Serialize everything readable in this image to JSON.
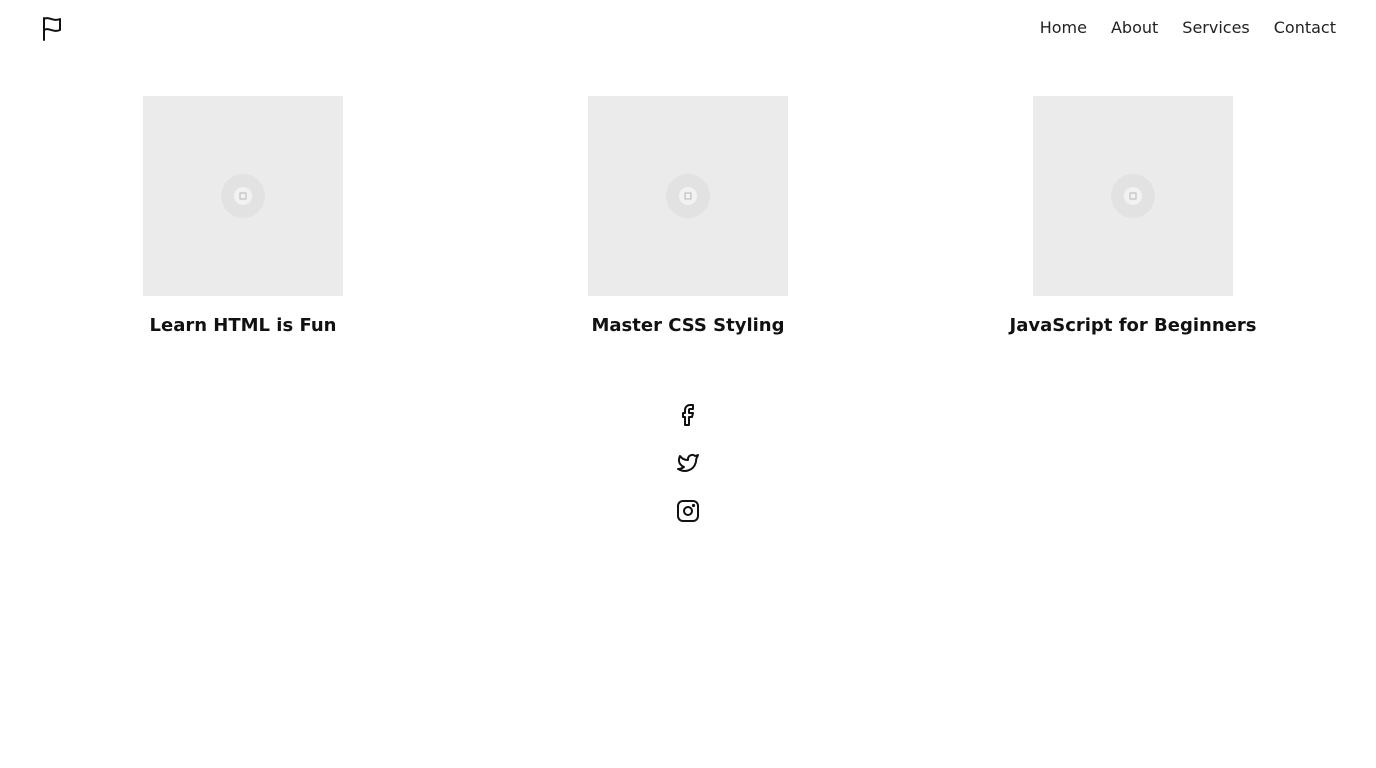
{
  "header": {
    "logo_icon": "flag-icon",
    "nav": [
      {
        "label": "Home"
      },
      {
        "label": "About"
      },
      {
        "label": "Services"
      },
      {
        "label": "Contact"
      }
    ]
  },
  "cards": [
    {
      "title": "Learn HTML is Fun",
      "image_icon": "image-placeholder-icon"
    },
    {
      "title": "Master CSS Styling",
      "image_icon": "image-placeholder-icon"
    },
    {
      "title": "JavaScript for Beginners",
      "image_icon": "image-placeholder-icon"
    }
  ],
  "social": [
    {
      "icon": "facebook-icon"
    },
    {
      "icon": "twitter-icon"
    },
    {
      "icon": "instagram-icon"
    }
  ],
  "colors": {
    "background": "#ffffff",
    "text": "#111111",
    "placeholder": "#ebebeb"
  }
}
